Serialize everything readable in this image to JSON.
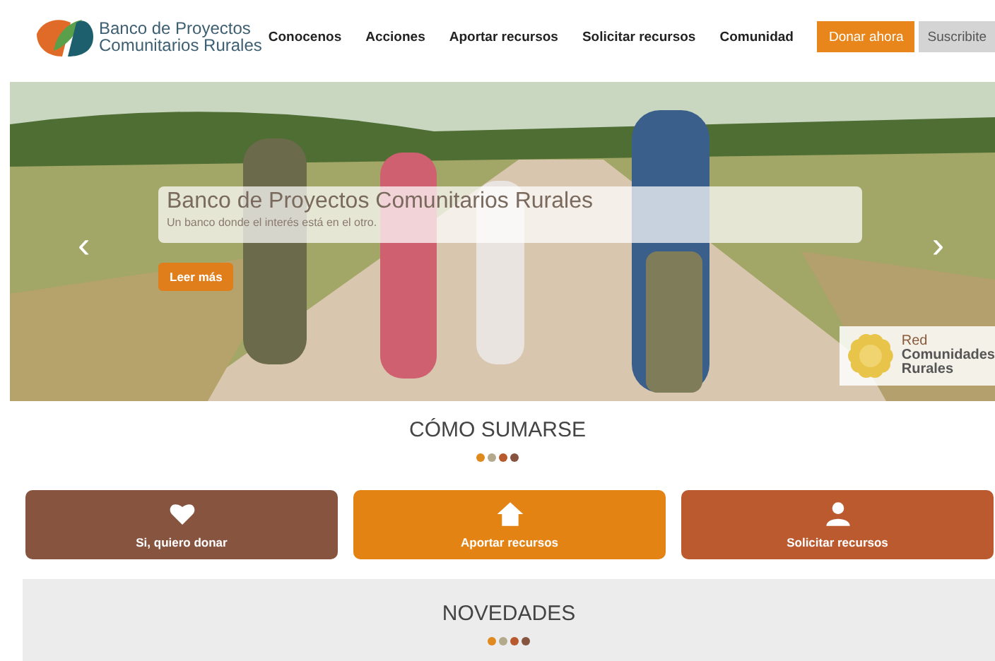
{
  "header": {
    "logo_text": "Banco de Proyectos Comunitarios Rurales",
    "nav": [
      {
        "label": "Conocenos",
        "kind": "link"
      },
      {
        "label": "Acciones",
        "kind": "link"
      },
      {
        "label": "Aportar recursos",
        "kind": "link"
      },
      {
        "label": "Solicitar recursos",
        "kind": "link"
      },
      {
        "label": "Comunidad",
        "kind": "link"
      },
      {
        "label": "Donar ahora",
        "kind": "primary"
      },
      {
        "label": "Suscribite",
        "kind": "secondary"
      }
    ]
  },
  "hero": {
    "kind": "picture",
    "title": "Banco de Proyectos Comunitarios Rurales",
    "subtitle": "Un banco donde el interés está en el otro.",
    "button": "Leer más",
    "prev": "‹",
    "next": "›",
    "badge": [
      "Red",
      "Comunidades",
      "Rurales"
    ]
  },
  "join": {
    "title": "CÓMO SUMARSE",
    "dots": [
      {
        "color": "#e08a1e"
      },
      {
        "color": "#b3a98c"
      },
      {
        "color": "#b85a2e"
      },
      {
        "color": "#875440"
      }
    ],
    "cards": [
      {
        "label": "Si, quiero donar",
        "kind": "heart",
        "color": "#875440"
      },
      {
        "label": "Aportar recursos",
        "kind": "home",
        "color": "#e38314"
      },
      {
        "label": "Solicitar recursos",
        "kind": "user",
        "color": "#bb5a2f"
      }
    ]
  },
  "news": {
    "title": "NOVEDADES",
    "dots": [
      {
        "color": "#e08a1e"
      },
      {
        "color": "#b3a98c"
      },
      {
        "color": "#b85a2e"
      },
      {
        "color": "#875440"
      }
    ]
  }
}
